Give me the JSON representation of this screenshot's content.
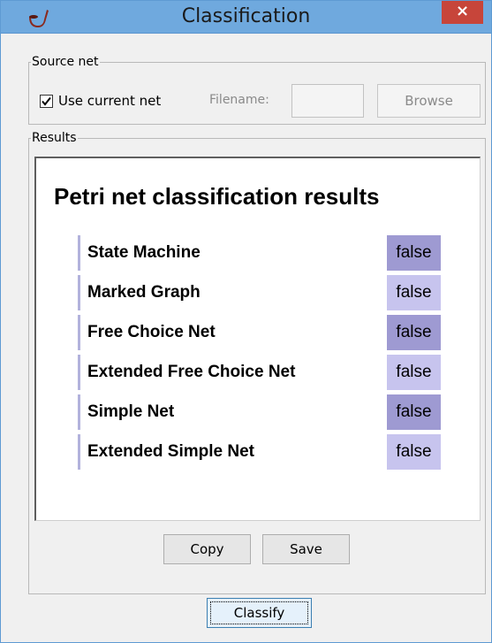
{
  "window": {
    "title": "Classification",
    "close_label": "×"
  },
  "source_net": {
    "legend": "Source net",
    "use_current_label": "Use current net",
    "use_current_checked": true,
    "filename_label": "Filename:",
    "filename_value": "",
    "browse_label": "Browse"
  },
  "results": {
    "legend": "Results",
    "heading": "Petri net classification results",
    "rows": [
      {
        "label": "State Machine",
        "value": "false"
      },
      {
        "label": "Marked Graph",
        "value": "false"
      },
      {
        "label": "Free Choice Net",
        "value": "false"
      },
      {
        "label": "Extended Free Choice Net",
        "value": "false"
      },
      {
        "label": "Simple Net",
        "value": "false"
      },
      {
        "label": "Extended Simple Net",
        "value": "false"
      }
    ]
  },
  "buttons": {
    "copy": "Copy",
    "save": "Save",
    "classify": "Classify"
  },
  "colors": {
    "titlebar": "#6fa9de",
    "close": "#c7453a",
    "value_dark": "#9e9ad2",
    "value_light": "#c7c4ee"
  }
}
